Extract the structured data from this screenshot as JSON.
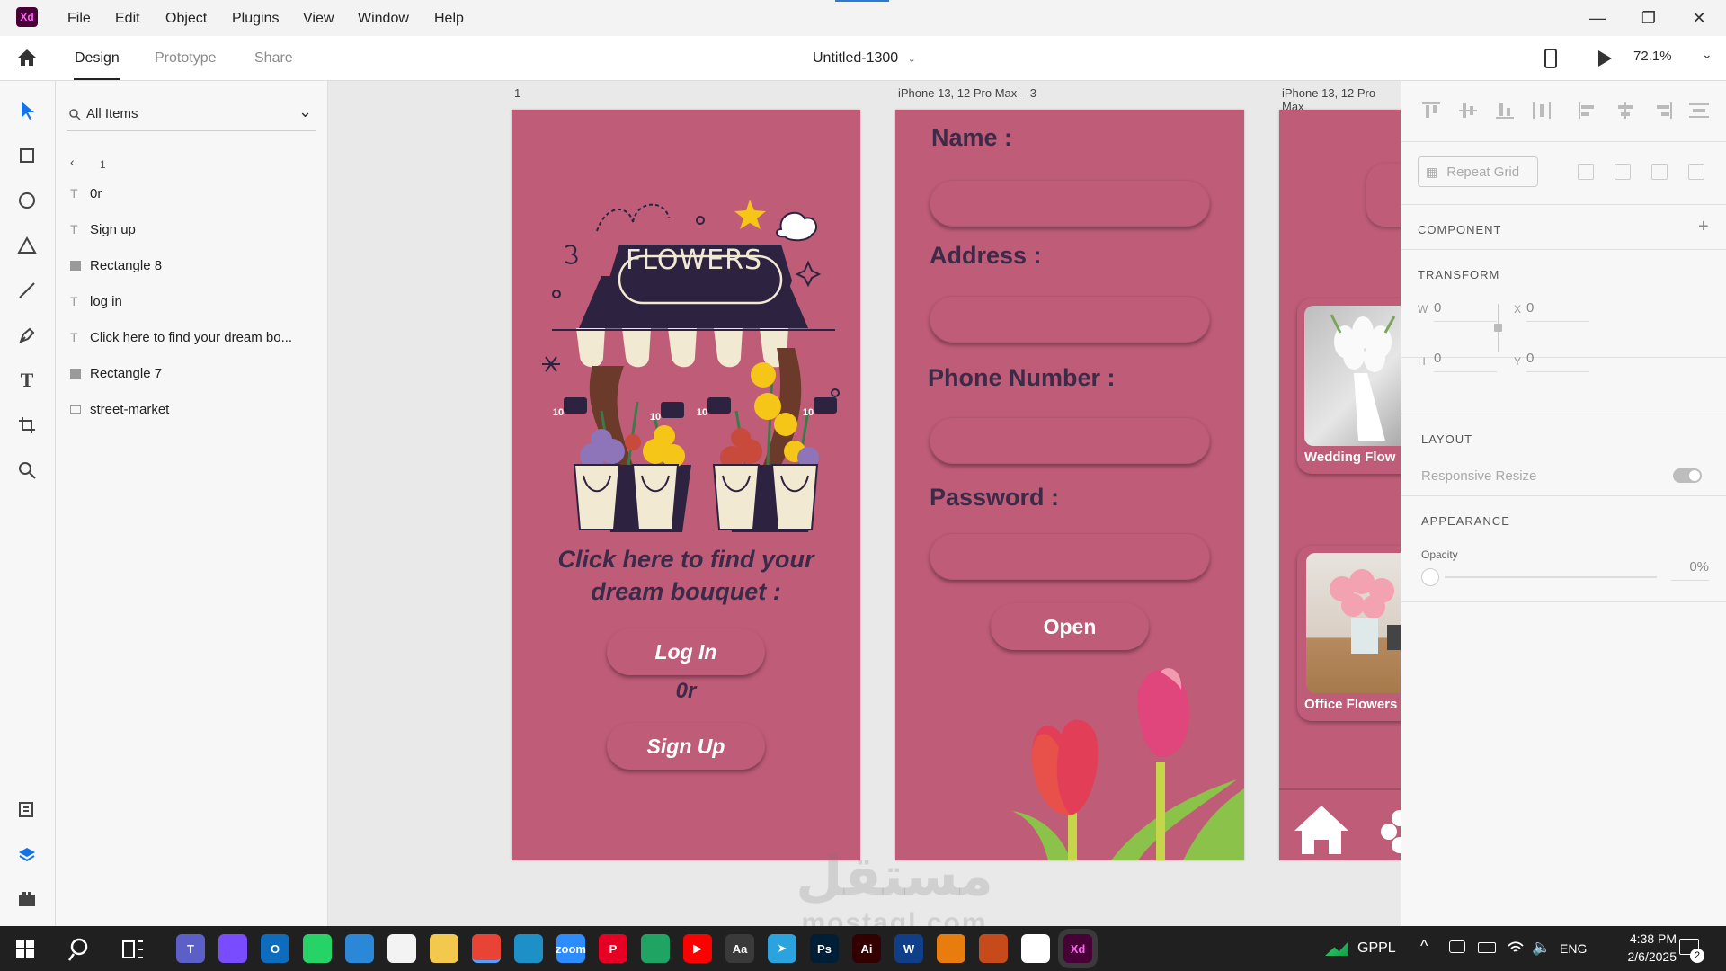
{
  "app": {
    "logo_text": "Xd",
    "brand_color": "#470137"
  },
  "menu": [
    "File",
    "Edit",
    "Object",
    "Plugins",
    "View",
    "Window",
    "Help"
  ],
  "window_controls": {
    "minimize": "—",
    "restore": "❐",
    "close": "✕"
  },
  "tabs": {
    "design": "Design",
    "prototype": "Prototype",
    "share": "Share"
  },
  "document_title": "Untitled-1300",
  "zoom": "72.1%",
  "layers": {
    "filter_label": "All Items",
    "back_label": "1",
    "items": [
      {
        "type": "text",
        "label": "0r"
      },
      {
        "type": "text",
        "label": "Sign up"
      },
      {
        "type": "rect",
        "label": "Rectangle 8"
      },
      {
        "type": "text",
        "label": "log in"
      },
      {
        "type": "text",
        "label": "Click here to find your dream bo..."
      },
      {
        "type": "rect",
        "label": "Rectangle 7"
      },
      {
        "type": "image",
        "label": "street-market"
      }
    ]
  },
  "artboards": {
    "a1": {
      "label": "1",
      "sign_text": "FLOWERS",
      "tagline": "Click here to find your dream bouquet :",
      "login": "Log In",
      "or": "0r",
      "signup": "Sign Up",
      "pot_prices": [
        "10",
        "10",
        "10",
        "10"
      ]
    },
    "a2": {
      "label": "iPhone 13, 12 Pro Max – 3",
      "name": "Name :",
      "address": "Address :",
      "phone": "Phone Number :",
      "password": "Password :",
      "open": "Open"
    },
    "a3": {
      "label": "iPhone 13, 12 Pro Max",
      "card1": "Wedding Flow",
      "card2": "Office Flowers"
    },
    "fill_color": "#bf5c78"
  },
  "inspector": {
    "repeat_grid": "Repeat Grid",
    "component": "COMPONENT",
    "transform": "TRANSFORM",
    "w_label": "W",
    "w": "0",
    "x_label": "X",
    "x": "0",
    "h_label": "H",
    "h": "0",
    "y_label": "Y",
    "y": "0",
    "layout": "LAYOUT",
    "responsive": "Responsive Resize",
    "appearance": "APPEARANCE",
    "opacity_label": "Opacity",
    "opacity": "0%"
  },
  "watermark": {
    "arabic": "مستقل",
    "latin": "mostaql.com"
  },
  "taskbar": {
    "gppl": "GPPL",
    "lang": "ENG",
    "time": "4:38 PM",
    "date": "2/6/2025",
    "notifications": "2",
    "apps": [
      {
        "name": "teams",
        "color": "#5b5fc7",
        "glyph": "T"
      },
      {
        "name": "copilot",
        "color": "#7a4cff",
        "glyph": ""
      },
      {
        "name": "outlook",
        "color": "#0f6cbd",
        "glyph": "O"
      },
      {
        "name": "whatsapp",
        "color": "#25d366",
        "glyph": ""
      },
      {
        "name": "network",
        "color": "#2b88d8",
        "glyph": ""
      },
      {
        "name": "store",
        "color": "#f3f3f3",
        "glyph": ""
      },
      {
        "name": "explorer",
        "color": "#f2c94c",
        "glyph": ""
      },
      {
        "name": "chrome",
        "color": "#e84335",
        "glyph": ""
      },
      {
        "name": "edge",
        "color": "#1e90c8",
        "glyph": ""
      },
      {
        "name": "zoom",
        "color": "#2d8cff",
        "glyph": "zoom"
      },
      {
        "name": "pinterest",
        "color": "#e60023",
        "glyph": "P"
      },
      {
        "name": "drive",
        "color": "#1fa463",
        "glyph": ""
      },
      {
        "name": "youtube",
        "color": "#ff0000",
        "glyph": "▶"
      },
      {
        "name": "font-app",
        "color": "#3a3a3a",
        "glyph": "Aa"
      },
      {
        "name": "telegram",
        "color": "#2aa3df",
        "glyph": "➤"
      },
      {
        "name": "photoshop",
        "color": "#001e36",
        "glyph": "Ps"
      },
      {
        "name": "illustrator",
        "color": "#330000",
        "glyph": "Ai"
      },
      {
        "name": "vscode",
        "color": "#0f3f88",
        "glyph": "W"
      },
      {
        "name": "blender",
        "color": "#e87d0d",
        "glyph": ""
      },
      {
        "name": "matlab",
        "color": "#c74b1a",
        "glyph": ""
      },
      {
        "name": "chatgpt",
        "color": "#ffffff",
        "glyph": ""
      },
      {
        "name": "xd",
        "color": "#470137",
        "glyph": "Xd"
      }
    ]
  }
}
